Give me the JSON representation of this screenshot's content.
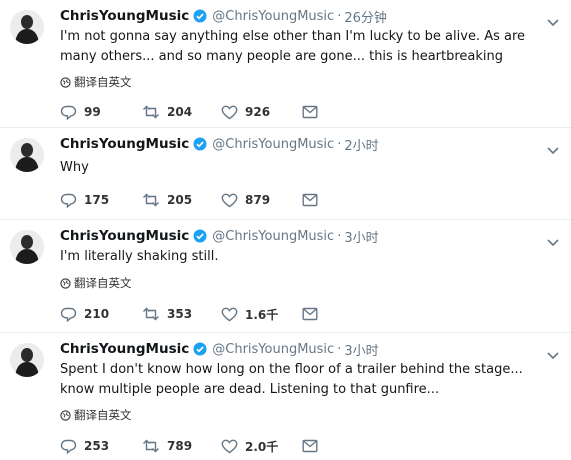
{
  "tweets": [
    {
      "name": "ChrisYoungMusic",
      "handle": "@ChrisYoungMusic",
      "time": "26分钟",
      "text": "I'm not gonna say anything else other than I'm lucky to be alive. As are many others... and so many people are gone... this is heartbreaking",
      "translate": "翻译自英文",
      "replies": "99",
      "retweets": "204",
      "likes": "926"
    },
    {
      "name": "ChrisYoungMusic",
      "handle": "@ChrisYoungMusic",
      "time": "2小时",
      "text": "Why",
      "replies": "175",
      "retweets": "205",
      "likes": "879"
    },
    {
      "name": "ChrisYoungMusic",
      "handle": "@ChrisYoungMusic",
      "time": "3小时",
      "text": "I'm literally shaking still.",
      "translate": "翻译自英文",
      "replies": "210",
      "retweets": "353",
      "likes": "1.6千"
    },
    {
      "name": "ChrisYoungMusic",
      "handle": "@ChrisYoungMusic",
      "time": "3小时",
      "text": "Spent I don't know how long on the floor of a trailer behind the stage... know multiple people are dead. Listening to that gunfire...",
      "translate": "翻译自英文",
      "replies": "253",
      "retweets": "789",
      "likes": "2.0千"
    }
  ],
  "icons": {
    "verified": "verified-badge-icon",
    "reply": "reply-icon",
    "retweet": "retweet-icon",
    "like": "heart-icon",
    "message": "envelope-icon",
    "caret": "chevron-down-icon",
    "translate": "globe-icon"
  },
  "colors": {
    "verified": "#1da1f2",
    "icon": "#657786",
    "text": "#14171a",
    "muted": "#657786",
    "divider": "#e6ecf0"
  }
}
